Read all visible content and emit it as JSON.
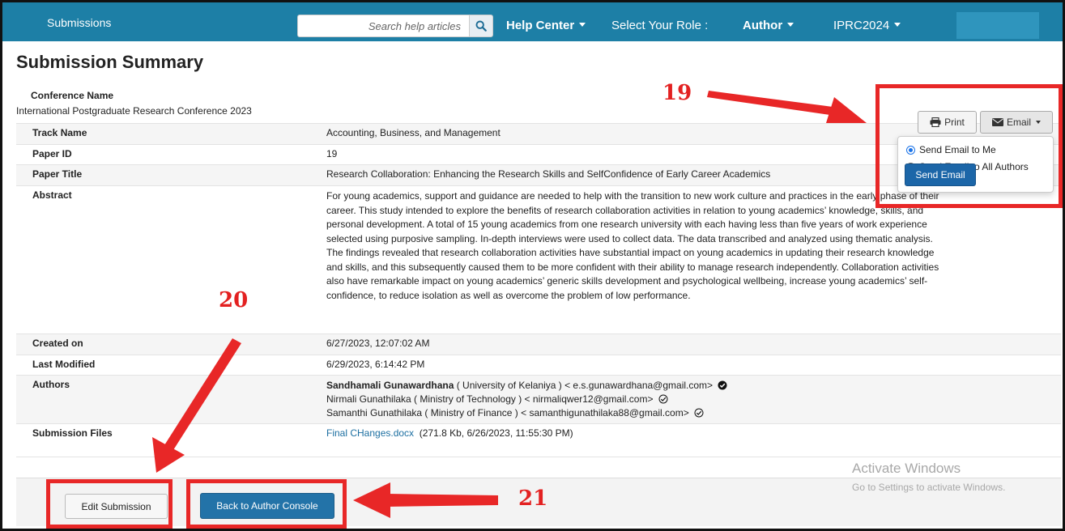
{
  "navbar": {
    "brand": "Submissions",
    "search_placeholder": "Search help articles",
    "help_center": "Help Center",
    "role_label": "Select Your Role :",
    "role_value": "Author",
    "conference_menu": "IPRC2024",
    "brand_color": "#1d7fa6"
  },
  "header": {
    "title": "Submission Summary",
    "conference_label": "Conference Name",
    "conference_value": "International Postgraduate Research Conference 2023"
  },
  "actions": {
    "print_label": "Print",
    "email_label": "Email",
    "email_menu": {
      "options": [
        {
          "label": "Send Email to Me",
          "selected": true
        },
        {
          "label": "Send Email to All Authors",
          "selected": false
        }
      ],
      "send_label": "Send Email"
    }
  },
  "summary": {
    "track_label": "Track Name",
    "track_value": "Accounting, Business, and Management",
    "paper_id_label": "Paper ID",
    "paper_id_value": "19",
    "paper_title_label": "Paper Title",
    "paper_title_value": "Research Collaboration: Enhancing the Research Skills and SelfConfidence of Early Career Academics",
    "abstract_label": "Abstract",
    "abstract_value": "For young academics, support and guidance are needed to help with the transition to new work culture and practices in the early phase of their career. This study intended to explore the benefits of research collaboration activities in relation to young academics’ knowledge, skills, and personal development. A total of 15 young academics from one research university with each having less than five years of work experience selected using purposive sampling. In-depth interviews were used to collect data. The data transcribed and analyzed using thematic analysis. The findings revealed that research collaboration activities have substantial impact on young academics in updating their research knowledge and skills, and this subsequently caused them to be more confident with their ability to manage research independently. Collaboration activities also have remarkable impact on young academics’ generic skills development and psychological wellbeing, increase young academics’ self-confidence, to reduce isolation as well as overcome the problem of low performance.",
    "created_label": "Created on",
    "created_value": "6/27/2023, 12:07:02 AM",
    "modified_label": "Last Modified",
    "modified_value": "6/29/2023, 6:14:42 PM",
    "authors_label": "Authors",
    "authors": [
      {
        "name": "Sandhamali Gunawardhana",
        "detail": " ( University of Kelaniya ) < e.s.gunawardhana@gmail.com>"
      },
      {
        "name": "Nirmali Gunathilaka",
        "detail": " ( Ministry of Technology ) < nirmaliqwer12@gmail.com>"
      },
      {
        "name": "Samanthi Gunathilaka",
        "detail": " ( Ministry of Finance ) < samanthigunathilaka88@gmail.com>"
      }
    ],
    "files_label": "Submission Files",
    "file_name": "Final CHanges.docx",
    "file_meta": "(271.8 Kb, 6/26/2023, 11:55:30 PM)"
  },
  "footer": {
    "edit_label": "Edit Submission",
    "back_label": "Back to Author Console"
  },
  "annotations": {
    "step_19": "19",
    "step_20": "20",
    "step_21": "21",
    "color": "#e82727"
  },
  "watermark": {
    "line1": "Activate Windows",
    "line2": "Go to Settings to activate Windows."
  }
}
